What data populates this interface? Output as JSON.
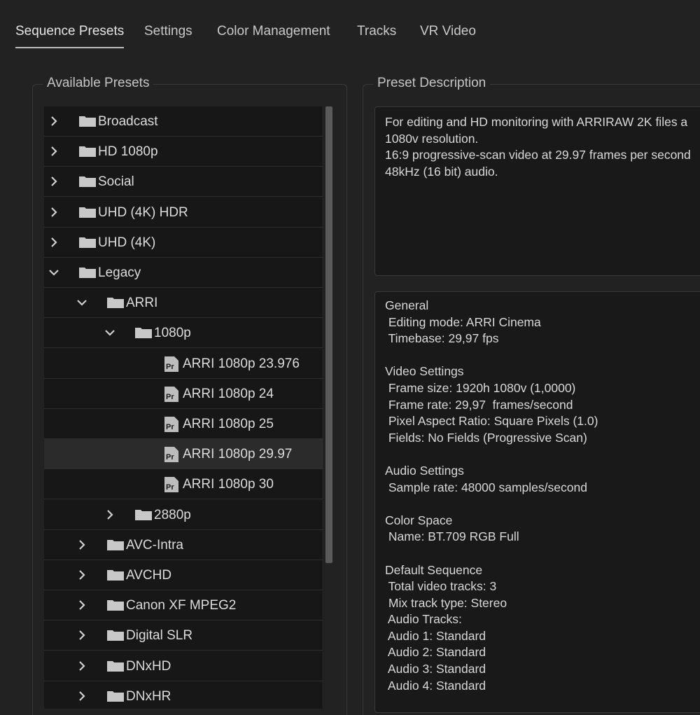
{
  "tabs": [
    "Sequence Presets",
    "Settings",
    "Color Management",
    "Tracks",
    "VR Video"
  ],
  "available_presets": {
    "title": "Available Presets",
    "items": [
      {
        "label": "Broadcast",
        "type": "folder",
        "expanded": false,
        "level": 0
      },
      {
        "label": "HD 1080p",
        "type": "folder",
        "expanded": false,
        "level": 0
      },
      {
        "label": "Social",
        "type": "folder",
        "expanded": false,
        "level": 0
      },
      {
        "label": "UHD (4K) HDR",
        "type": "folder",
        "expanded": false,
        "level": 0
      },
      {
        "label": "UHD (4K)",
        "type": "folder",
        "expanded": false,
        "level": 0
      },
      {
        "label": "Legacy",
        "type": "folder",
        "expanded": true,
        "level": 0
      },
      {
        "label": "ARRI",
        "type": "folder",
        "expanded": true,
        "level": 1
      },
      {
        "label": "1080p",
        "type": "folder",
        "expanded": true,
        "level": 2
      },
      {
        "label": "ARRI 1080p 23.976",
        "type": "preset",
        "level": 3
      },
      {
        "label": "ARRI 1080p 24",
        "type": "preset",
        "level": 3
      },
      {
        "label": "ARRI 1080p 25",
        "type": "preset",
        "level": 3
      },
      {
        "label": "ARRI 1080p 29.97",
        "type": "preset",
        "level": 3,
        "selected": true
      },
      {
        "label": "ARRI 1080p 30",
        "type": "preset",
        "level": 3
      },
      {
        "label": "2880p",
        "type": "folder",
        "expanded": false,
        "level": 2
      },
      {
        "label": "AVC-Intra",
        "type": "folder",
        "expanded": false,
        "level": 1
      },
      {
        "label": "AVCHD",
        "type": "folder",
        "expanded": false,
        "level": 1
      },
      {
        "label": "Canon XF MPEG2",
        "type": "folder",
        "expanded": false,
        "level": 1
      },
      {
        "label": "Digital SLR",
        "type": "folder",
        "expanded": false,
        "level": 1
      },
      {
        "label": "DNxHD",
        "type": "folder",
        "expanded": false,
        "level": 1
      },
      {
        "label": "DNxHR",
        "type": "folder",
        "expanded": false,
        "level": 1
      }
    ]
  },
  "preset_description": {
    "title": "Preset Description",
    "text": "For editing and HD monitoring with ARRIRAW 2K files a\n1080v resolution.\n16:9 progressive-scan video at 29.97 frames per second\n48kHz (16 bit) audio."
  },
  "info": {
    "text": "General\n Editing mode: ARRI Cinema\n Timebase: 29,97 fps\n\nVideo Settings\n Frame size: 1920h 1080v (1,0000)\n Frame rate: 29,97  frames/second\n Pixel Aspect Ratio: Square Pixels (1.0)\n Fields: No Fields (Progressive Scan)\n\nAudio Settings\n Sample rate: 48000 samples/second\n\nColor Space\n Name: BT.709 RGB Full\n\nDefault Sequence\n Total video tracks: 3\n Mix track type: Stereo\n Audio Tracks:\n Audio 1: Standard\n Audio 2: Standard\n Audio 3: Standard\n Audio 4: Standard"
  },
  "colors": {
    "background": "#222222",
    "panel": "#191919",
    "selected_row": "#2b2b2b",
    "text": "#dcdcdc",
    "folder_icon": "#c8c8c8"
  },
  "icons": {
    "collapsed": "chevron-right-icon",
    "expanded": "chevron-down-icon",
    "folder": "folder-icon",
    "preset": "premiere-preset-icon"
  }
}
